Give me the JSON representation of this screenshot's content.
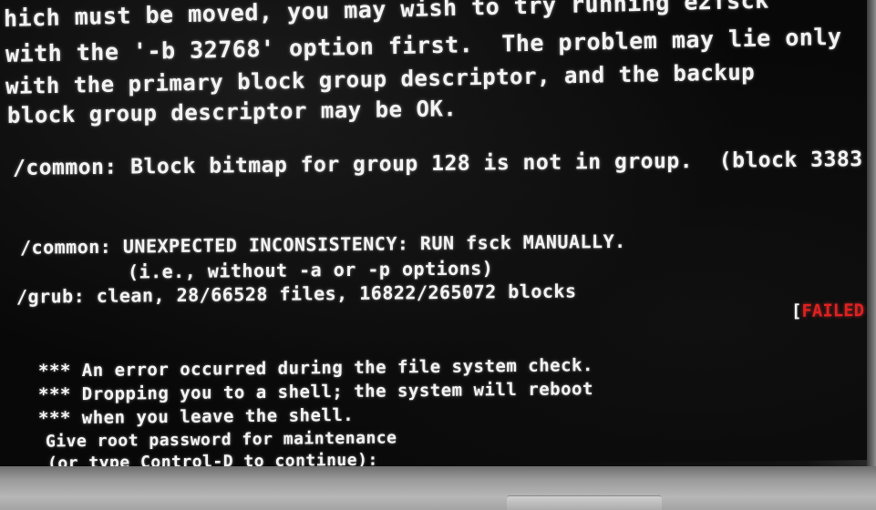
{
  "console": {
    "lines": [
      "hich must be moved, you may wish to try running e2fsck",
      "with the '-b 32768' option first.  The problem may lie only",
      "with the primary block group descriptor, and the backup",
      "block group descriptor may be OK.",
      "/common: Block bitmap for group 128 is not in group.  (block 3383",
      "/common: UNEXPECTED INCONSISTENCY: RUN fsck MANUALLY.",
      "(i.e., without -a or -p options)",
      "/grub: clean, 28/66528 files, 16822/265072 blocks",
      "*** An error occurred during the file system check.",
      "*** Dropping you to a shell; the system will reboot",
      "*** when you leave the shell.",
      "Give root password for maintenance",
      "(or type Control-D to continue):"
    ],
    "status": {
      "open_bracket": "[",
      "label": "FAILED"
    }
  },
  "colors": {
    "text": "#f3f3f3",
    "failed": "#e02020",
    "background": "#080808",
    "bezel": "#a4a4a4"
  }
}
